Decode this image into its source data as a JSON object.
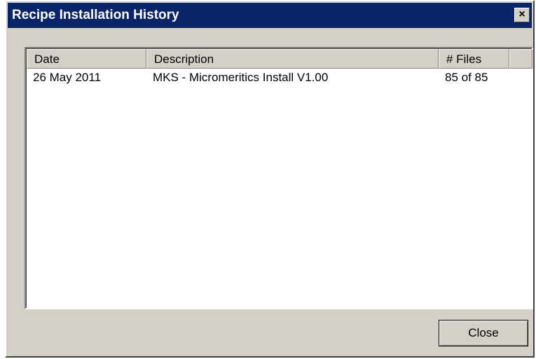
{
  "window": {
    "title": "Recipe Installation History",
    "close_glyph": "×"
  },
  "table": {
    "columns": [
      "Date",
      "Description",
      "# Files"
    ],
    "rows": [
      {
        "date": "26 May 2011",
        "description": "MKS - Micromeritics Install V1.00",
        "files": "85 of 85"
      }
    ]
  },
  "footer": {
    "close_label": "Close"
  },
  "colors": {
    "titlebar": "#0a246a",
    "face": "#d4d0c8",
    "list_background": "#ffffff"
  }
}
